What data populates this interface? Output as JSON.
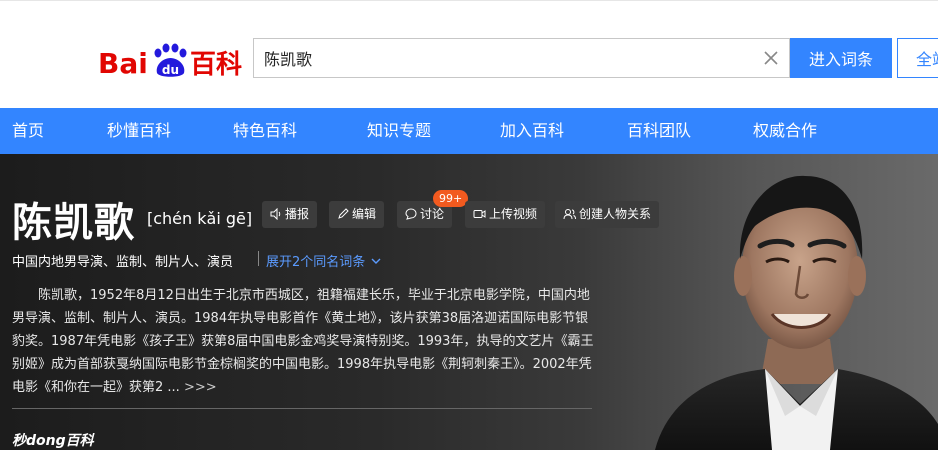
{
  "header": {
    "logo_text_left": "Bai",
    "logo_text_du": "du",
    "logo_text_right": "百科",
    "search_value": "陈凯歌",
    "enter_button": "进入词条",
    "full_button": "全站"
  },
  "nav": {
    "items": [
      "首页",
      "秒懂百科",
      "特色百科",
      "知识专题",
      "加入百科",
      "百科团队",
      "权威合作"
    ]
  },
  "entry": {
    "title": "陈凯歌",
    "pinyin": "[chén kǎi gē]",
    "tools": {
      "play": "播报",
      "edit": "编辑",
      "discuss": "讨论",
      "discuss_badge": "99+",
      "upload": "上传视频",
      "relation": "创建人物关系"
    },
    "subtitle": "中国内地男导演、监制、制片人、演员",
    "expand": "展开2个同名词条",
    "summary_line1": "陈凯歌，1952年8月12日出生于北京市西城区，祖籍福建长乐，毕业于北京电影学院，中国内地男导演、监制、制片人、演员。1984年执导电影首作《黄土地》，该片获第38届洛迦诺国际电影节银豹奖。1987年凭电影《孩子王》获第8届中国电影金鸡奖导演特别奖。1993年，执导的文艺片《霸王别姬》成为首部获戛纳国际电影节金棕榈奖的中国电影。1998年执导电影《荆轲刺秦王》。2002年凭电影《和你在一起》获第2",
    "summary_ellipsis": " ... ",
    "more_label": ">>>",
    "miaodong": "秒dong百科"
  }
}
